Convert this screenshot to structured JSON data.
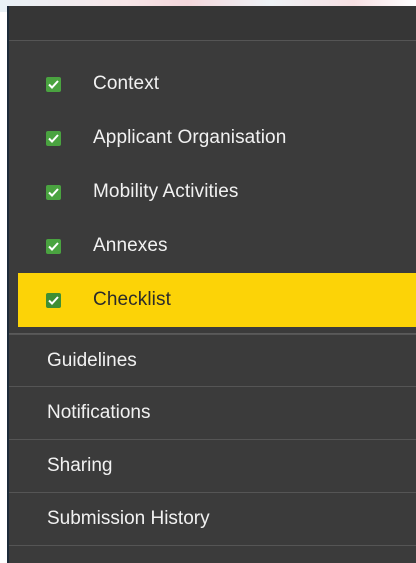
{
  "steps": [
    {
      "label": "Context",
      "checked": true,
      "active": false
    },
    {
      "label": "Applicant Organisation",
      "checked": true,
      "active": false
    },
    {
      "label": "Mobility Activities",
      "checked": true,
      "active": false
    },
    {
      "label": "Annexes",
      "checked": true,
      "active": false
    },
    {
      "label": "Checklist",
      "checked": true,
      "active": true
    }
  ],
  "links": [
    {
      "label": "Guidelines"
    },
    {
      "label": "Notifications"
    },
    {
      "label": "Sharing"
    },
    {
      "label": "Submission History"
    }
  ],
  "colors": {
    "sidebar_bg": "#3b3b3b",
    "active_bg": "#fcd307",
    "check_green": "#4aa340",
    "text_light": "#f1f1f1",
    "text_dark": "#2b2b2b"
  },
  "icons": {
    "step_check": "checkbox-checked-icon"
  }
}
